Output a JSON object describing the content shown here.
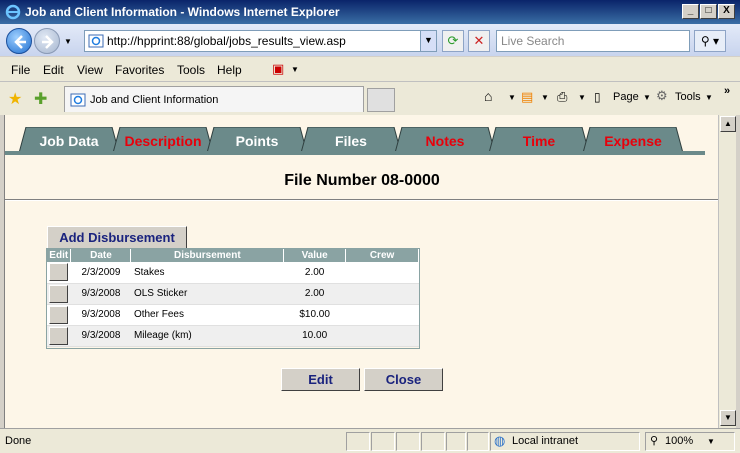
{
  "window": {
    "title": "Job and Client Information - Windows Internet Explorer",
    "minimize": "_",
    "maximize": "□",
    "close": "X"
  },
  "address": {
    "url": "http://hpprint:88/global/jobs_results_view.asp",
    "search_placeholder": "Live Search"
  },
  "menu": {
    "items": [
      "File",
      "Edit",
      "View",
      "Favorites",
      "Tools",
      "Help"
    ]
  },
  "browser_tab": {
    "label": "Job and Client Information"
  },
  "toolbar": {
    "page_label": "Page",
    "tools_label": "Tools"
  },
  "app_tabs": [
    {
      "label": "Job Data",
      "color": "#ffffff"
    },
    {
      "label": "Description",
      "color": "#e8000b"
    },
    {
      "label": "Points",
      "color": "#ffffff"
    },
    {
      "label": "Files",
      "color": "#ffffff"
    },
    {
      "label": "Notes",
      "color": "#e8000b"
    },
    {
      "label": "Time",
      "color": "#e8000b"
    },
    {
      "label": "Expense",
      "color": "#e8000b"
    }
  ],
  "main": {
    "file_number": "File Number 08-0000",
    "add_button": "Add Disbursement",
    "edit_button": "Edit",
    "close_button": "Close"
  },
  "table": {
    "headers": [
      "Edit",
      "Date",
      "Disbursement",
      "Value",
      "Crew"
    ],
    "rows": [
      {
        "date": "2/3/2009",
        "disbursement": "Stakes",
        "value": "2.00",
        "crew": ""
      },
      {
        "date": "9/3/2008",
        "disbursement": "OLS Sticker",
        "value": "2.00",
        "crew": ""
      },
      {
        "date": "9/3/2008",
        "disbursement": "Other Fees",
        "value": "$10.00",
        "crew": ""
      },
      {
        "date": "9/3/2008",
        "disbursement": "Mileage (km)",
        "value": "10.00",
        "crew": ""
      }
    ]
  },
  "status": {
    "text": "Done",
    "zone": "Local intranet",
    "zoom": "100%"
  },
  "colors": {
    "tab_fill": "#6b8a8a",
    "header_fill": "#8aa3a3",
    "content_bg": "#fdf6e8"
  }
}
